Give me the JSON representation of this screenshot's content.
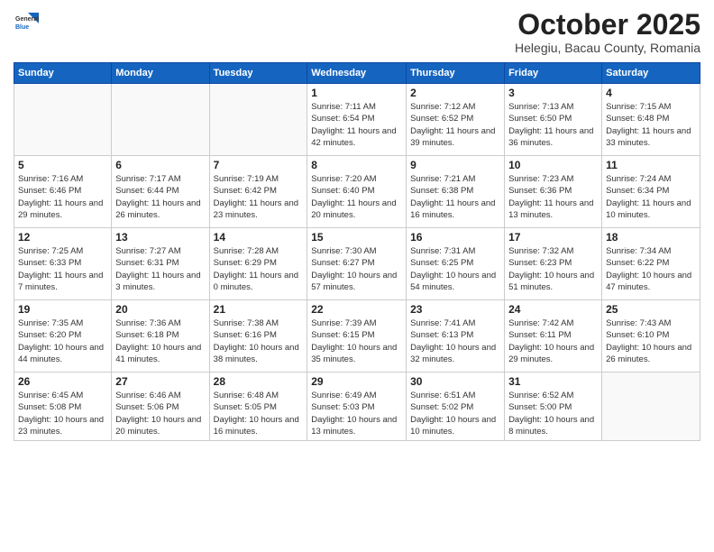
{
  "header": {
    "logo_general": "General",
    "logo_blue": "Blue",
    "month_title": "October 2025",
    "location": "Helegiu, Bacau County, Romania"
  },
  "days_of_week": [
    "Sunday",
    "Monday",
    "Tuesday",
    "Wednesday",
    "Thursday",
    "Friday",
    "Saturday"
  ],
  "weeks": [
    [
      {
        "day": "",
        "info": ""
      },
      {
        "day": "",
        "info": ""
      },
      {
        "day": "",
        "info": ""
      },
      {
        "day": "1",
        "info": "Sunrise: 7:11 AM\nSunset: 6:54 PM\nDaylight: 11 hours and 42 minutes."
      },
      {
        "day": "2",
        "info": "Sunrise: 7:12 AM\nSunset: 6:52 PM\nDaylight: 11 hours and 39 minutes."
      },
      {
        "day": "3",
        "info": "Sunrise: 7:13 AM\nSunset: 6:50 PM\nDaylight: 11 hours and 36 minutes."
      },
      {
        "day": "4",
        "info": "Sunrise: 7:15 AM\nSunset: 6:48 PM\nDaylight: 11 hours and 33 minutes."
      }
    ],
    [
      {
        "day": "5",
        "info": "Sunrise: 7:16 AM\nSunset: 6:46 PM\nDaylight: 11 hours and 29 minutes."
      },
      {
        "day": "6",
        "info": "Sunrise: 7:17 AM\nSunset: 6:44 PM\nDaylight: 11 hours and 26 minutes."
      },
      {
        "day": "7",
        "info": "Sunrise: 7:19 AM\nSunset: 6:42 PM\nDaylight: 11 hours and 23 minutes."
      },
      {
        "day": "8",
        "info": "Sunrise: 7:20 AM\nSunset: 6:40 PM\nDaylight: 11 hours and 20 minutes."
      },
      {
        "day": "9",
        "info": "Sunrise: 7:21 AM\nSunset: 6:38 PM\nDaylight: 11 hours and 16 minutes."
      },
      {
        "day": "10",
        "info": "Sunrise: 7:23 AM\nSunset: 6:36 PM\nDaylight: 11 hours and 13 minutes."
      },
      {
        "day": "11",
        "info": "Sunrise: 7:24 AM\nSunset: 6:34 PM\nDaylight: 11 hours and 10 minutes."
      }
    ],
    [
      {
        "day": "12",
        "info": "Sunrise: 7:25 AM\nSunset: 6:33 PM\nDaylight: 11 hours and 7 minutes."
      },
      {
        "day": "13",
        "info": "Sunrise: 7:27 AM\nSunset: 6:31 PM\nDaylight: 11 hours and 3 minutes."
      },
      {
        "day": "14",
        "info": "Sunrise: 7:28 AM\nSunset: 6:29 PM\nDaylight: 11 hours and 0 minutes."
      },
      {
        "day": "15",
        "info": "Sunrise: 7:30 AM\nSunset: 6:27 PM\nDaylight: 10 hours and 57 minutes."
      },
      {
        "day": "16",
        "info": "Sunrise: 7:31 AM\nSunset: 6:25 PM\nDaylight: 10 hours and 54 minutes."
      },
      {
        "day": "17",
        "info": "Sunrise: 7:32 AM\nSunset: 6:23 PM\nDaylight: 10 hours and 51 minutes."
      },
      {
        "day": "18",
        "info": "Sunrise: 7:34 AM\nSunset: 6:22 PM\nDaylight: 10 hours and 47 minutes."
      }
    ],
    [
      {
        "day": "19",
        "info": "Sunrise: 7:35 AM\nSunset: 6:20 PM\nDaylight: 10 hours and 44 minutes."
      },
      {
        "day": "20",
        "info": "Sunrise: 7:36 AM\nSunset: 6:18 PM\nDaylight: 10 hours and 41 minutes."
      },
      {
        "day": "21",
        "info": "Sunrise: 7:38 AM\nSunset: 6:16 PM\nDaylight: 10 hours and 38 minutes."
      },
      {
        "day": "22",
        "info": "Sunrise: 7:39 AM\nSunset: 6:15 PM\nDaylight: 10 hours and 35 minutes."
      },
      {
        "day": "23",
        "info": "Sunrise: 7:41 AM\nSunset: 6:13 PM\nDaylight: 10 hours and 32 minutes."
      },
      {
        "day": "24",
        "info": "Sunrise: 7:42 AM\nSunset: 6:11 PM\nDaylight: 10 hours and 29 minutes."
      },
      {
        "day": "25",
        "info": "Sunrise: 7:43 AM\nSunset: 6:10 PM\nDaylight: 10 hours and 26 minutes."
      }
    ],
    [
      {
        "day": "26",
        "info": "Sunrise: 6:45 AM\nSunset: 5:08 PM\nDaylight: 10 hours and 23 minutes."
      },
      {
        "day": "27",
        "info": "Sunrise: 6:46 AM\nSunset: 5:06 PM\nDaylight: 10 hours and 20 minutes."
      },
      {
        "day": "28",
        "info": "Sunrise: 6:48 AM\nSunset: 5:05 PM\nDaylight: 10 hours and 16 minutes."
      },
      {
        "day": "29",
        "info": "Sunrise: 6:49 AM\nSunset: 5:03 PM\nDaylight: 10 hours and 13 minutes."
      },
      {
        "day": "30",
        "info": "Sunrise: 6:51 AM\nSunset: 5:02 PM\nDaylight: 10 hours and 10 minutes."
      },
      {
        "day": "31",
        "info": "Sunrise: 6:52 AM\nSunset: 5:00 PM\nDaylight: 10 hours and 8 minutes."
      },
      {
        "day": "",
        "info": ""
      }
    ]
  ]
}
